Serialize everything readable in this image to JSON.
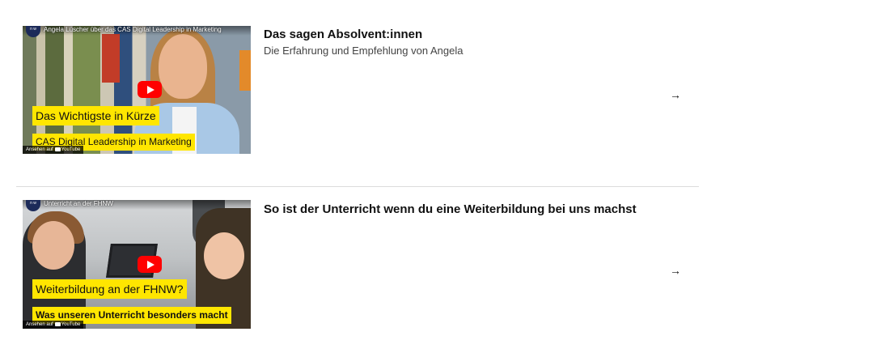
{
  "cards": [
    {
      "video": {
        "title": "Angela Lüscher über das CAS Digital Leadership in Marketing",
        "channel_logo_text": "n w",
        "caption_line_1": "Das Wichtigste in Kürze",
        "caption_line_2": "CAS Digital Leadership in Marketing",
        "watch_on": "Ansehen auf",
        "platform": "YouTube"
      },
      "title": "Das sagen Absolvent:innen",
      "subtitle": "Die Erfahrung und Empfehlung von Angela",
      "arrow": "→"
    },
    {
      "video": {
        "title": "Unterricht an der FHNW",
        "channel_logo_text": "n w",
        "caption_line_1": "Weiterbildung an der FHNW?",
        "caption_line_2": "Was unseren Unterricht besonders macht",
        "watch_on": "Ansehen auf",
        "platform": "YouTube"
      },
      "title": "So ist der Unterricht wenn du eine Weiterbildung bei uns machst",
      "subtitle": "",
      "arrow": "→"
    }
  ],
  "colors": {
    "caption_highlight": "#ffe600",
    "play_button": "#ff0000",
    "divider": "#dcdcdc"
  }
}
